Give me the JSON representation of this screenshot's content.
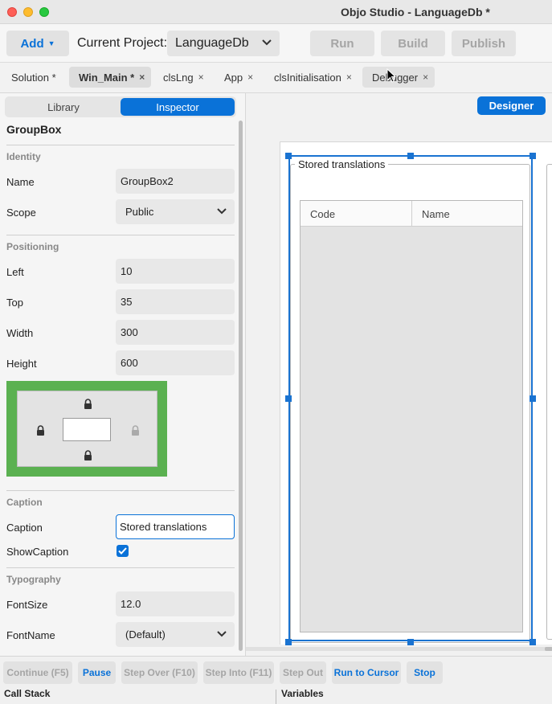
{
  "window": {
    "title": "Objo Studio - LanguageDb *"
  },
  "toolbar": {
    "add_label": "Add",
    "current_project_label": "Current Project:",
    "project_value": "LanguageDb",
    "run_label": "Run",
    "build_label": "Build",
    "publish_label": "Publish"
  },
  "tabs": [
    {
      "label": "Solution *"
    },
    {
      "label": "Win_Main *"
    },
    {
      "label": "clsLng"
    },
    {
      "label": "App"
    },
    {
      "label": "clsInitialisation"
    },
    {
      "label": "Debugger"
    }
  ],
  "inspector": {
    "segment_library": "Library",
    "segment_inspector": "Inspector",
    "control_type": "GroupBox",
    "sections": {
      "identity": "Identity",
      "positioning": "Positioning",
      "caption": "Caption",
      "typography": "Typography"
    },
    "props": {
      "name": {
        "label": "Name",
        "value": "GroupBox2"
      },
      "scope": {
        "label": "Scope",
        "value": "Public"
      },
      "left": {
        "label": "Left",
        "value": "10"
      },
      "top": {
        "label": "Top",
        "value": "35"
      },
      "width": {
        "label": "Width",
        "value": "300"
      },
      "height": {
        "label": "Height",
        "value": "600"
      },
      "caption": {
        "label": "Caption",
        "value": "Stored translations"
      },
      "showcaption": {
        "label": "ShowCaption",
        "checked": true
      },
      "fontsize": {
        "label": "FontSize",
        "value": "12.0"
      },
      "fontname": {
        "label": "FontName",
        "value": "(Default)"
      }
    },
    "anchors": {
      "top": "locked",
      "left": "locked",
      "right": "unlocked",
      "bottom": "locked"
    }
  },
  "designer": {
    "button_label": "Designer",
    "groupbox_caption": "Stored translations",
    "grid_columns": [
      "Code",
      "Name"
    ]
  },
  "debug": {
    "continue": "Continue (F5)",
    "pause": "Pause",
    "step_over": "Step Over (F10)",
    "step_into": "Step Into (F11)",
    "step_out": "Step Out",
    "run_to_cursor": "Run to Cursor",
    "stop": "Stop"
  },
  "bottom": {
    "call_stack": "Call Stack",
    "variables": "Variables"
  },
  "colors": {
    "accent": "#0a72d8",
    "anchor_green": "#5bb151",
    "selection_blue": "#1a73d1"
  }
}
